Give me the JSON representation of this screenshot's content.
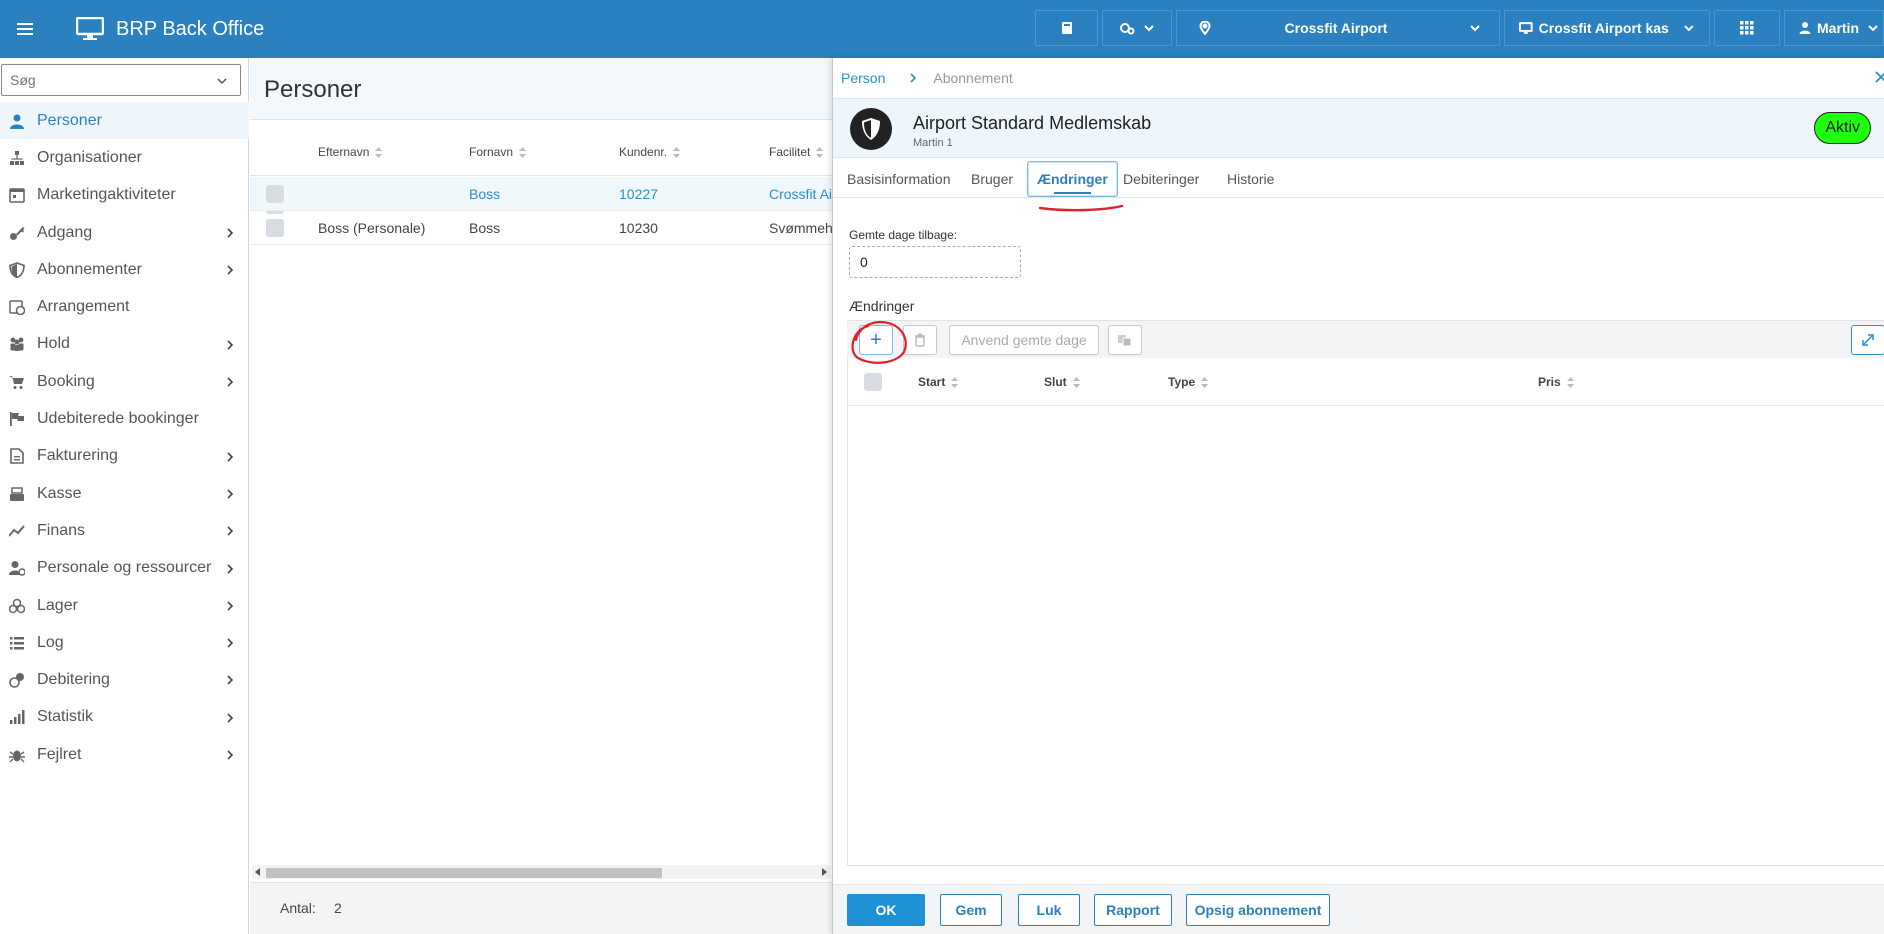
{
  "app": {
    "title": "BRP Back Office"
  },
  "topbar": {
    "location": "Crossfit Airport",
    "register": "Crossfit Airport kas",
    "user": "Martin"
  },
  "sidebar": {
    "search_placeholder": "Søg",
    "items": [
      {
        "label": "Personer",
        "icon": "person-icon",
        "active": true
      },
      {
        "label": "Organisationer",
        "icon": "org-chart-icon"
      },
      {
        "label": "Marketingaktiviteter",
        "icon": "calendar-icon"
      },
      {
        "label": "Adgang",
        "icon": "key-icon",
        "arrow": true
      },
      {
        "label": "Abonnementer",
        "icon": "shield-icon",
        "arrow": true
      },
      {
        "label": "Arrangement",
        "icon": "calendar-clock-icon"
      },
      {
        "label": "Hold",
        "icon": "group-icon",
        "arrow": true
      },
      {
        "label": "Booking",
        "icon": "cart-icon",
        "arrow": true
      },
      {
        "label": "Udebiterede bookinger",
        "icon": "flag-icon"
      },
      {
        "label": "Fakturering",
        "icon": "document-icon",
        "arrow": true
      },
      {
        "label": "Kasse",
        "icon": "cash-register-icon",
        "arrow": true
      },
      {
        "label": "Finans",
        "icon": "trend-icon",
        "arrow": true
      },
      {
        "label": "Personale og ressourcer",
        "icon": "staff-icon",
        "arrow": true
      },
      {
        "label": "Lager",
        "icon": "boxes-icon",
        "arrow": true
      },
      {
        "label": "Log",
        "icon": "list-icon",
        "arrow": true
      },
      {
        "label": "Debitering",
        "icon": "coin-icon",
        "arrow": true
      },
      {
        "label": "Statistik",
        "icon": "bar-chart-icon",
        "arrow": true
      },
      {
        "label": "Fejlret",
        "icon": "bug-icon",
        "arrow": true
      }
    ]
  },
  "persons": {
    "title": "Personer",
    "columns": [
      "Efternavn",
      "Fornavn",
      "Kundenr.",
      "Facilitet"
    ],
    "rows": [
      {
        "efternavn": "",
        "fornavn": "Boss",
        "kundenr": "10227",
        "facilitet": "Crossfit Ai"
      },
      {
        "efternavn": "Boss (Personale)",
        "fornavn": "Boss",
        "kundenr": "10230",
        "facilitet": "Svømmeh"
      }
    ],
    "count_label": "Antal:",
    "count": "2"
  },
  "panel": {
    "breadcrumb": [
      "Person",
      "Abonnement"
    ],
    "subscription_title": "Airport Standard Medlemskab",
    "subscription_sub": "Martin 1",
    "status": "Aktiv",
    "tabs": [
      "Basisinformation",
      "Bruger",
      "Ændringer",
      "Debiteringer",
      "Historie"
    ],
    "active_tab": "Ændringer",
    "saved_days_label": "Gemte dage tilbage:",
    "saved_days_value": "0",
    "changes_title": "Ændringer",
    "toolbar": {
      "add": "+",
      "apply_saved": "Anvend gemte dage"
    },
    "changes_columns": [
      "Start",
      "Slut",
      "Type",
      "Pris"
    ],
    "footer": [
      "OK",
      "Gem",
      "Luk",
      "Rapport",
      "Opsig abonnement"
    ]
  },
  "colors": {
    "topbar": "#2b80c0",
    "accent": "#2b90c8",
    "status": "#1dff0e",
    "annotation": "#e0202a"
  }
}
